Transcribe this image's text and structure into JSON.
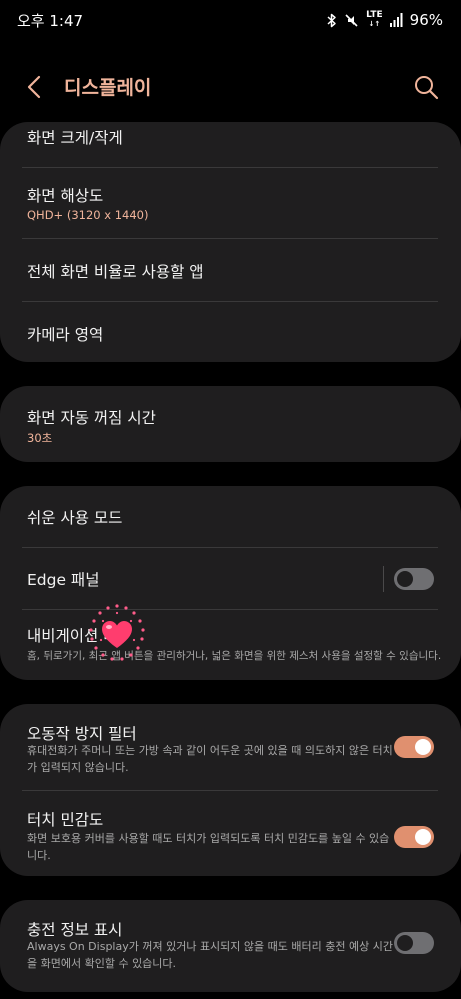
{
  "status": {
    "time": "오후 1:47",
    "network": "LTE",
    "battery": "96%"
  },
  "header": {
    "title": "디스플레이"
  },
  "rows": {
    "screen_zoom": {
      "title": "화면 크게/작게"
    },
    "resolution": {
      "title": "화면 해상도",
      "sub": "QHD+ (3120 x 1440)"
    },
    "fullscreen_apps": {
      "title": "전체 화면 비율로 사용할 앱"
    },
    "camera_cutout": {
      "title": "카메라 영역"
    },
    "screen_timeout": {
      "title": "화면 자동 꺼짐 시간",
      "sub": "30초"
    },
    "easy_mode": {
      "title": "쉬운 사용 모드"
    },
    "edge_panels": {
      "title": "Edge 패널",
      "enabled": false
    },
    "navigation_bar": {
      "title": "내비게이션 바",
      "desc": "홈, 뒤로가기, 최근 앱 버튼을 관리하거나, 넓은 화면을 위한 제스처 사용을 설정할 수 있습니다."
    },
    "accidental_touch": {
      "title": "오동작 방지 필터",
      "desc": "휴대전화가 주머니 또는 가방 속과 같이 어두운 곳에 있을 때 의도하지 않은 터치가 입력되지 않습니다.",
      "enabled": true
    },
    "touch_sensitivity": {
      "title": "터치 민감도",
      "desc": "화면 보호용 커버를 사용할 때도 터치가 입력되도록 터치 민감도를 높일 수 있습니다.",
      "enabled": true
    },
    "charging_info": {
      "title": "충전 정보 표시",
      "desc": "Always On Display가 꺼져 있거나 표시되지 않을 때도 배터리 충전 예상 시간을 화면에서 확인할 수 있습니다.",
      "enabled": false
    }
  },
  "colors": {
    "accent": "#f0b49b",
    "toggle_on": "#e0906f",
    "toggle_off": "#6f6f72",
    "card": "#1f1e1f",
    "background": "#000000"
  },
  "icons": [
    "bluetooth-icon",
    "mute-icon",
    "signal-icon",
    "back-arrow-icon",
    "search-icon",
    "heart-sticker-icon"
  ]
}
